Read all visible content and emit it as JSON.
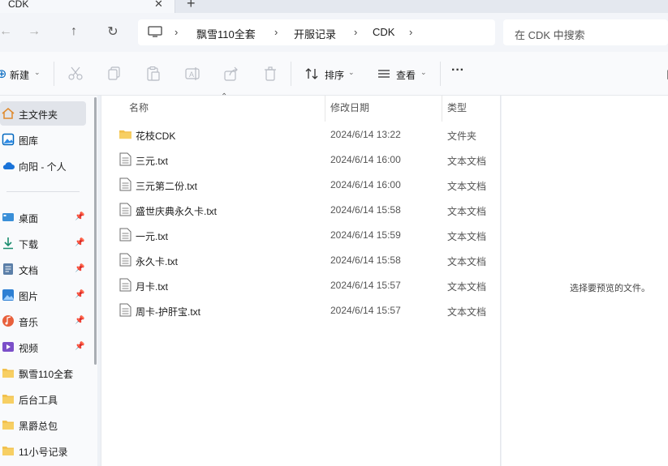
{
  "tab": {
    "title": "CDK",
    "close": "✕",
    "new_tab": "+"
  },
  "nav": {
    "back": "←",
    "forward": "→",
    "up": "↑",
    "refresh": "↻"
  },
  "breadcrumb": [
    "飘雪110全套",
    "开服记录",
    "CDK"
  ],
  "search": {
    "placeholder": "在 CDK 中搜索"
  },
  "toolbar": {
    "new_label": "新建",
    "sort_label": "排序",
    "view_label": "查看",
    "more_label": "···"
  },
  "sidebar": {
    "top_items": [
      {
        "label": "主文件夹",
        "icon": "home-icon"
      },
      {
        "label": "图库",
        "icon": "gallery-icon"
      },
      {
        "label": "向阳 - 个人",
        "icon": "cloud-icon"
      }
    ],
    "pinned_items": [
      {
        "label": "桌面",
        "icon": "desktop-icon"
      },
      {
        "label": "下载",
        "icon": "download-icon"
      },
      {
        "label": "文档",
        "icon": "document-icon"
      },
      {
        "label": "图片",
        "icon": "pictures-icon"
      },
      {
        "label": "音乐",
        "icon": "music-icon"
      },
      {
        "label": "视频",
        "icon": "video-icon"
      }
    ],
    "folder_items": [
      {
        "label": "飘雪110全套",
        "icon": "folder-icon"
      },
      {
        "label": "后台工具",
        "icon": "folder-icon"
      },
      {
        "label": "黑爵总包",
        "icon": "folder-icon"
      },
      {
        "label": "11小号记录",
        "icon": "folder-icon"
      }
    ]
  },
  "columns": {
    "name": "名称",
    "date": "修改日期",
    "type": "类型"
  },
  "files": [
    {
      "name": "花枝CDK",
      "date": "2024/6/14 13:22",
      "type": "文件夹",
      "icon": "folder-icon"
    },
    {
      "name": "三元.txt",
      "date": "2024/6/14 16:00",
      "type": "文本文档",
      "icon": "text-file-icon"
    },
    {
      "name": "三元第二份.txt",
      "date": "2024/6/14 16:00",
      "type": "文本文档",
      "icon": "text-file-icon"
    },
    {
      "name": "盛世庆典永久卡.txt",
      "date": "2024/6/14 15:58",
      "type": "文本文档",
      "icon": "text-file-icon"
    },
    {
      "name": "一元.txt",
      "date": "2024/6/14 15:59",
      "type": "文本文档",
      "icon": "text-file-icon"
    },
    {
      "name": "永久卡.txt",
      "date": "2024/6/14 15:58",
      "type": "文本文档",
      "icon": "text-file-icon"
    },
    {
      "name": "月卡.txt",
      "date": "2024/6/14 15:57",
      "type": "文本文档",
      "icon": "text-file-icon"
    },
    {
      "name": "周卡-护肝宝.txt",
      "date": "2024/6/14 15:57",
      "type": "文本文档",
      "icon": "text-file-icon"
    }
  ],
  "preview": {
    "message": "选择要预览的文件。"
  },
  "colors": {
    "folder": "#f2c14e",
    "accent": "#0067c0",
    "active_bg": "#e1e4ea"
  }
}
